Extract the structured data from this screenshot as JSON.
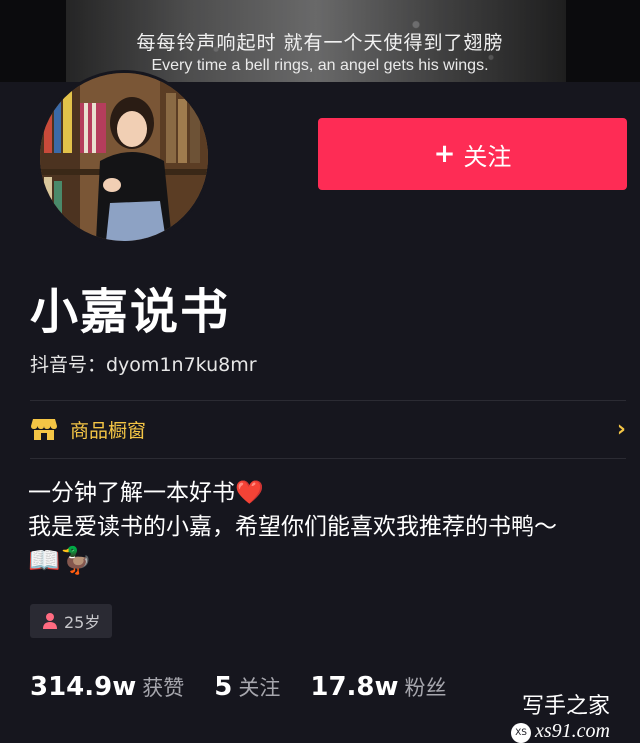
{
  "banner": {
    "caption_zh": "每每铃声响起时 就有一个天使得到了翅膀",
    "caption_en": "Every time a bell rings, an angel gets his wings."
  },
  "profile": {
    "name": "小嘉说书",
    "douyin_id": "抖音号：dyom1n7ku8mr",
    "follow_label": "关注",
    "follow_icon": "plus-icon",
    "accent_color": "#fe2c55"
  },
  "shop": {
    "label": "商品橱窗",
    "icon": "shop-icon",
    "color": "#f4c545"
  },
  "bio": {
    "line1": "一分钟了解一本好书",
    "line1_emoji": "❤️",
    "line2": "我是爱读书的小嘉，希望你们能喜欢我推荐的书鸭～",
    "line3_emoji": "📖🦆"
  },
  "tags": {
    "age": "25岁"
  },
  "stats": [
    {
      "value": "314.9w",
      "label": "获赞"
    },
    {
      "value": "5",
      "label": "关注"
    },
    {
      "value": "17.8w",
      "label": "粉丝"
    }
  ],
  "watermark": {
    "title": "写手之家",
    "logo": "XS",
    "url": "xs91.com"
  }
}
